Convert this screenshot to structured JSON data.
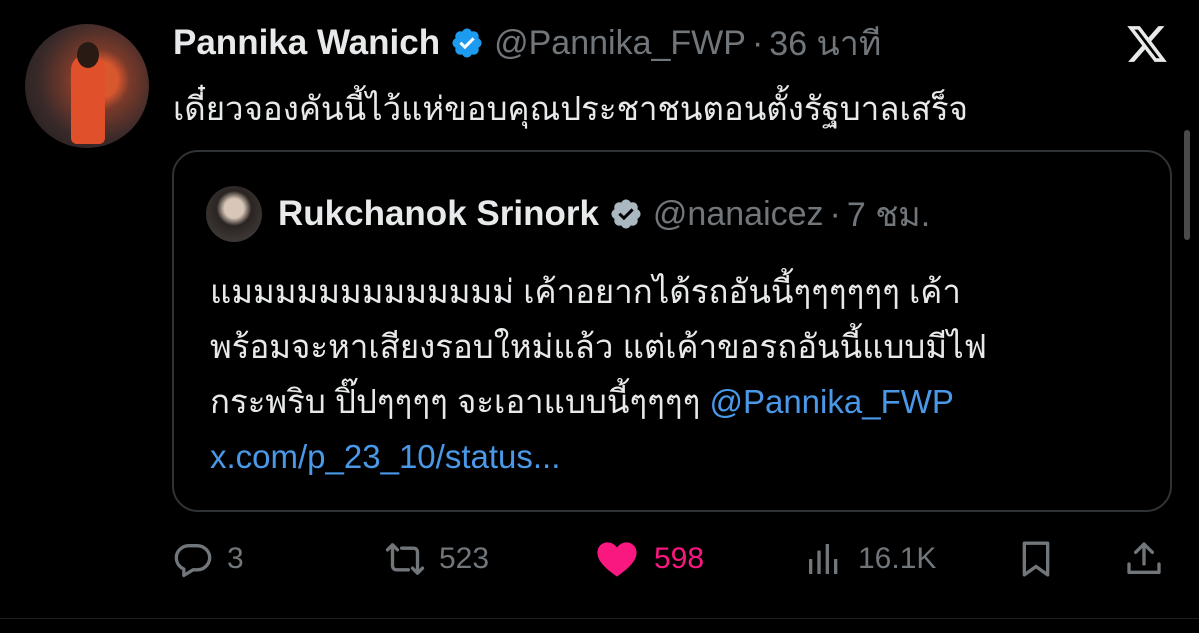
{
  "tweet": {
    "author_name": "Pannika Wanich",
    "author_handle": "@Pannika_FWP",
    "separator": "·",
    "time": "36 นาที",
    "text": "เดี๋ยวจองคันนี้ไว้แห่ขอบคุณประชาชนตอนตั้งรัฐบาลเสร็จ",
    "verified": true,
    "verified_color": "#1d9bf0"
  },
  "quote": {
    "author_name": "Rukchanok Srinork",
    "author_handle": "@nanaicez",
    "separator": "·",
    "time": "7 ชม.",
    "verified": true,
    "verified_color": "#aab8c2",
    "lines": [
      "แมมมมมมมมมมมมม่ เค้าอยากได้รถอันนี้ๆๆๆๆๆๆ เค้า",
      "พร้อมจะหาเสียงรอบใหม่แล้ว แต่เค้าขอรถอันนี้แบบมีไฟ",
      "กระพริบ ปิ๊ปๆๆๆๆ จะเอาแบบนี้ๆๆๆๆ"
    ],
    "mention": "@Pannika_FWP",
    "link": "x.com/p_23_10/status..."
  },
  "actions": {
    "replies": "3",
    "reposts": "523",
    "likes": "598",
    "views": "16.1K"
  },
  "icons": {
    "logo": "x-logo-icon",
    "reply": "reply-icon",
    "repost": "repost-icon",
    "like": "heart-icon",
    "views": "views-icon",
    "bookmark": "bookmark-icon",
    "share": "share-icon"
  },
  "colors": {
    "background": "#000000",
    "text": "#e7e9ea",
    "muted": "#71767b",
    "link": "#4a99e9",
    "like": "#f91880"
  }
}
